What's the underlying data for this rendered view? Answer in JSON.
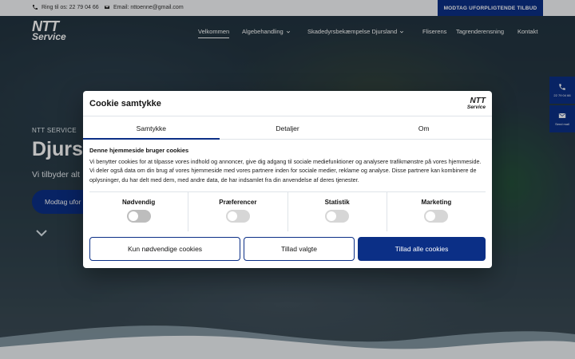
{
  "topbar": {
    "phone_label": "Ring til os: 22 79 04 66",
    "email_label": "Email: nttoenne@gmail.com",
    "cta": "MODTAG UFORPLIGTENDE TILBUD"
  },
  "logo": {
    "line1": "NTT",
    "line2": "Service"
  },
  "nav": {
    "items": [
      {
        "label": "Velkommen"
      },
      {
        "label": "Algebehandling"
      },
      {
        "label": "Skadedyrsbekæmpelse Djursland"
      },
      {
        "label": "Fliserens"
      },
      {
        "label": "Tagrenderensning"
      },
      {
        "label": "Kontakt"
      }
    ]
  },
  "hero": {
    "eyebrow": "NTT SERVICE",
    "title": "Djurs",
    "subtitle": "Vi tilbyder alt",
    "button": "Modtag ufor"
  },
  "side_widgets": {
    "phone": "22 79 04 66",
    "mail": "Send mail"
  },
  "cookie": {
    "title": "Cookie samtykke",
    "logo_line1": "NTT",
    "logo_line2": "Service",
    "tabs": [
      {
        "label": "Samtykke",
        "active": true
      },
      {
        "label": "Detaljer",
        "active": false
      },
      {
        "label": "Om",
        "active": false
      }
    ],
    "heading": "Denne hjemmeside bruger cookies",
    "body": "Vi benytter cookies for at tilpasse vores indhold og annoncer, give dig adgang til sociale mediefunktioner og analysere trafikmønstre på vores hjemmeside. Vi deler også data om din brug af vores hjemmeside med vores partnere inden for sociale medier, reklame og analyse. Disse partnere kan kombinere de oplysninger, du har delt med dem, med andre data, de har indsamlet fra din anvendelse af deres tjenester.",
    "toggles": [
      {
        "label": "Nødvendig",
        "on": false,
        "disabled": true
      },
      {
        "label": "Præferencer",
        "on": false,
        "disabled": false
      },
      {
        "label": "Statistik",
        "on": false,
        "disabled": false
      },
      {
        "label": "Marketing",
        "on": false,
        "disabled": false
      }
    ],
    "buttons": {
      "necessary_only": "Kun nødvendige cookies",
      "allow_selected": "Tillad valgte",
      "allow_all": "Tillad alle cookies"
    }
  },
  "colors": {
    "brand": "#0b2f86",
    "topbar_bg": "#f4f6f8"
  }
}
